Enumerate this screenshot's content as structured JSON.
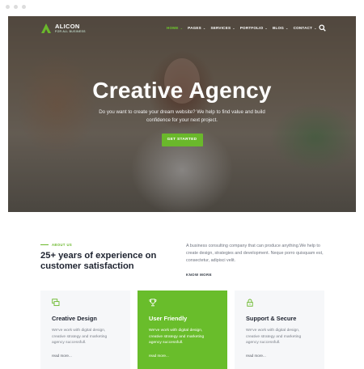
{
  "brand": {
    "name": "ALICON",
    "tagline": "FOR ALL BUSINESS",
    "accent_color": "#6ab82b"
  },
  "nav": {
    "items": [
      {
        "label": "HOME",
        "active": true
      },
      {
        "label": "PAGES",
        "active": false
      },
      {
        "label": "SERVICES",
        "active": false
      },
      {
        "label": "PORTFOLIO",
        "active": false
      },
      {
        "label": "BLOG",
        "active": false
      },
      {
        "label": "CONTACT",
        "active": false
      }
    ],
    "dropdown_icon": "chevron-down-icon",
    "search_icon": "search-icon"
  },
  "hero": {
    "title": "Creative Agency",
    "description": "Do you want to create your dream website? We help to find value and build confidence for your next project.",
    "button_label": "GET STARTED"
  },
  "about": {
    "eyebrow": "ABOUT US",
    "title": "25+ years of experience on customer satisfaction",
    "text": "A business consulting company that can produce anything.We help to create design, strategies and development. Neque porro quisquam est, consectetur, adipisci velit.",
    "link": "KNOW MORE"
  },
  "cards": [
    {
      "icon": "layers-icon",
      "title": "Creative Design",
      "text": "We've work with digital design, creative strategy and marketing agency successfull.",
      "link": "read more..."
    },
    {
      "icon": "trophy-icon",
      "title": "User Friendly",
      "text": "We've work with digital design, creative strategy and marketing agency successfull.",
      "link": "read more..."
    },
    {
      "icon": "lock-icon",
      "title": "Support & Secure",
      "text": "We've work with digital design, creative strategy and marketing agency successfull.",
      "link": "read more..."
    }
  ]
}
